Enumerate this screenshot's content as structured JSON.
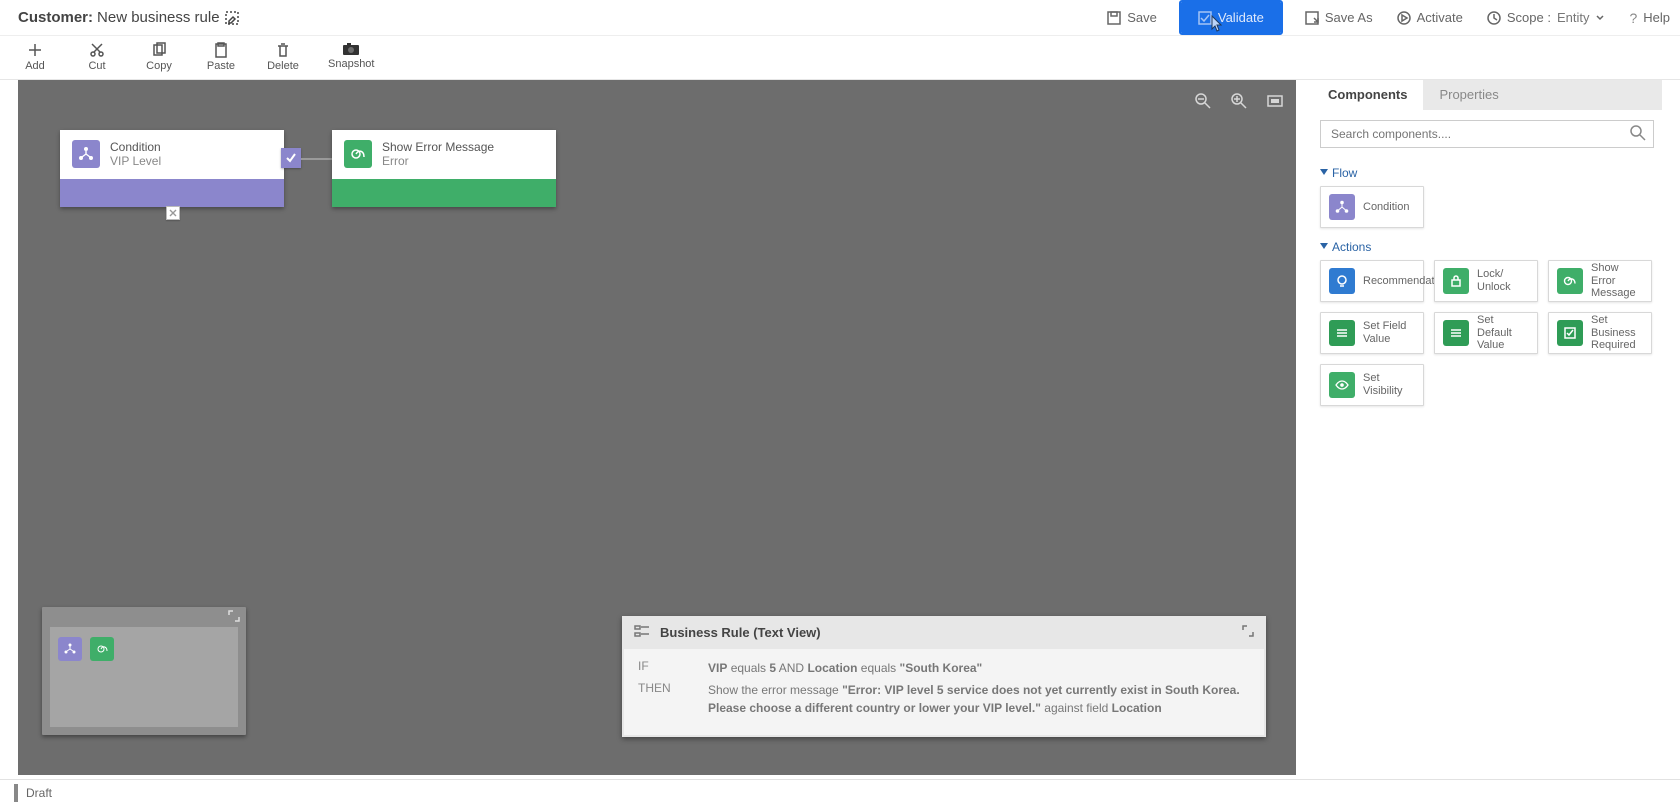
{
  "header": {
    "prefix": "Customer:",
    "title": "New business rule",
    "cmds": {
      "save": "Save",
      "validate": "Validate",
      "save_as": "Save As",
      "activate": "Activate",
      "scope_label": "Scope :",
      "scope_value": "Entity",
      "help": "Help"
    }
  },
  "ribbon": {
    "add": "Add",
    "cut": "Cut",
    "copy": "Copy",
    "paste": "Paste",
    "delete": "Delete",
    "snapshot": "Snapshot"
  },
  "canvas": {
    "node_condition": {
      "title": "Condition",
      "sub": "VIP Level"
    },
    "node_error": {
      "title": "Show Error Message",
      "sub": "Error"
    }
  },
  "textview": {
    "title": "Business Rule (Text View)",
    "if_key": "IF",
    "then_key": "THEN",
    "if_vip": "VIP",
    "if_eq1": "equals",
    "if_v1": "5",
    "if_and": "AND",
    "if_loc": "Location",
    "if_eq2": "equals",
    "if_v2": "\"South Korea\"",
    "then_pre": "Show the error message ",
    "then_msg": "\"Error: VIP level 5 service does not yet currently exist in South Korea. Please choose a different country or lower your VIP level.\"",
    "then_post1": " against field ",
    "then_post2": "Location"
  },
  "side": {
    "tab_components": "Components",
    "tab_properties": "Properties",
    "search_placeholder": "Search components....",
    "group_flow": "Flow",
    "group_actions": "Actions",
    "tiles": {
      "condition": "Condition",
      "recommendation": "Recommendation",
      "lock": "Lock/ Unlock",
      "show_error": "Show Error Message",
      "set_field": "Set Field Value",
      "set_default": "Set Default Value",
      "set_required": "Set Business Required",
      "set_visibility": "Set Visibility"
    }
  },
  "status": "Draft"
}
